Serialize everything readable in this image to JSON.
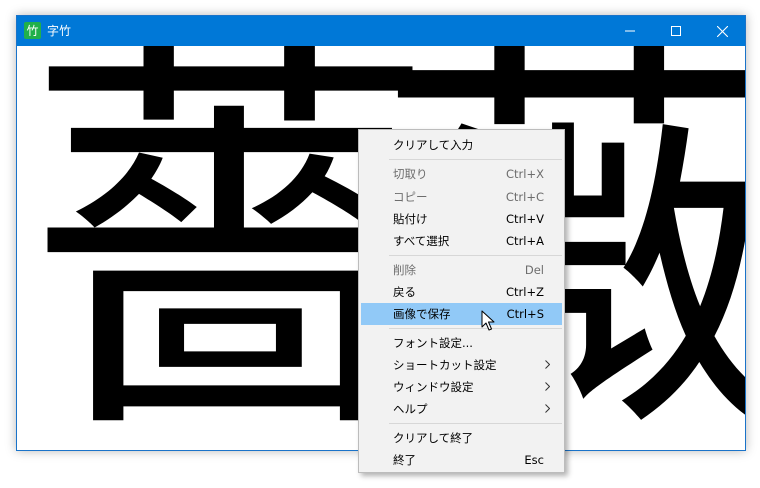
{
  "window": {
    "title": "字竹",
    "app_icon_glyph": "竹",
    "accent_color": "#0078d7"
  },
  "canvas": {
    "characters": [
      "薔",
      "薇"
    ]
  },
  "context_menu": {
    "items": [
      {
        "label": "クリアして入力",
        "shortcut": "",
        "disabled": false
      },
      {
        "label": "切取り",
        "shortcut": "Ctrl+X",
        "disabled": true
      },
      {
        "label": "コピー",
        "shortcut": "Ctrl+C",
        "disabled": true
      },
      {
        "label": "貼付け",
        "shortcut": "Ctrl+V",
        "disabled": false
      },
      {
        "label": "すべて選択",
        "shortcut": "Ctrl+A",
        "disabled": false
      },
      {
        "label": "削除",
        "shortcut": "Del",
        "disabled": true
      },
      {
        "label": "戻る",
        "shortcut": "Ctrl+Z",
        "disabled": false
      },
      {
        "label": "画像で保存",
        "shortcut": "Ctrl+S",
        "disabled": false,
        "highlighted": true
      },
      {
        "label": "フォント設定...",
        "shortcut": "",
        "disabled": false
      },
      {
        "label": "ショートカット設定",
        "shortcut": "",
        "submenu": true
      },
      {
        "label": "ウィンドウ設定",
        "shortcut": "",
        "submenu": true
      },
      {
        "label": "ヘルプ",
        "shortcut": "",
        "submenu": true
      },
      {
        "label": "クリアして終了",
        "shortcut": "",
        "disabled": false
      },
      {
        "label": "終了",
        "shortcut": "Esc",
        "disabled": false
      }
    ],
    "highlight_color": "#91c9f7"
  }
}
